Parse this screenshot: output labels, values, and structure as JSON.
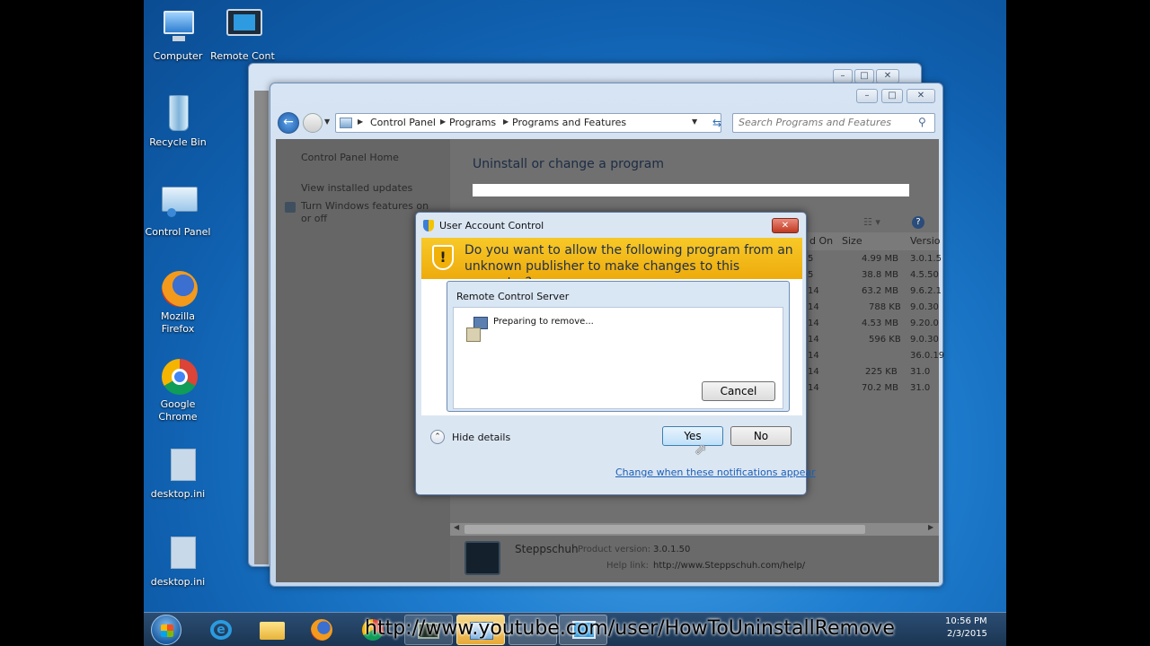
{
  "desktop": {
    "icons": [
      {
        "label": "Computer"
      },
      {
        "label": "Remote Cont"
      },
      {
        "label": "Recycle Bin"
      },
      {
        "label": "Control Panel"
      },
      {
        "label": "Mozilla Firefox"
      },
      {
        "label": "Google Chrome"
      },
      {
        "label": "desktop.ini"
      },
      {
        "label": "desktop.ini"
      }
    ]
  },
  "explorer": {
    "breadcrumb": [
      "Control Panel",
      "Programs",
      "Programs and Features"
    ],
    "search_placeholder": "Search Programs and Features",
    "sidebar": {
      "home": "Control Panel Home",
      "updates": "View installed updates",
      "features": "Turn Windows features on or off"
    },
    "heading": "Uninstall or change a program",
    "columns": {
      "installed_on": "d On",
      "size": "Size",
      "version": "Versio"
    },
    "rows": [
      {
        "date": "5",
        "size": "4.99 MB",
        "version": "3.0.1.5"
      },
      {
        "date": "5",
        "size": "38.8 MB",
        "version": "4.5.50"
      },
      {
        "date": "14",
        "size": "63.2 MB",
        "version": "9.6.2.1"
      },
      {
        "date": "14",
        "size": "788 KB",
        "version": "9.0.30"
      },
      {
        "date": "14",
        "size": "4.53 MB",
        "version": "9.20.0"
      },
      {
        "date": "14",
        "size": "596 KB",
        "version": "9.0.30"
      },
      {
        "date": "14",
        "size": "",
        "version": "36.0.19"
      },
      {
        "date": "14",
        "size": "225 KB",
        "version": "31.0"
      },
      {
        "date": "14",
        "size": "70.2 MB",
        "version": "31.0"
      }
    ],
    "details": {
      "name": "Steppschuh",
      "version_label": "Product version:",
      "version": "3.0.1.50",
      "help_label": "Help link:",
      "help": "http://www.Steppschuh.com/help/"
    }
  },
  "uac": {
    "title": "User Account Control",
    "question": "Do you want to allow the following program from an unknown publisher to make changes to this computer?",
    "inner_title": "Remote Control Server",
    "status": "Preparing to remove...",
    "cancel": "Cancel",
    "hide_details": "Hide details",
    "yes": "Yes",
    "no": "No",
    "link": "Change when these notifications appear"
  },
  "taskbar": {
    "time": "10:56 PM",
    "date": "2/3/2015"
  },
  "watermark": "http://www.youtube.com/user/HowToUninstallRemove"
}
